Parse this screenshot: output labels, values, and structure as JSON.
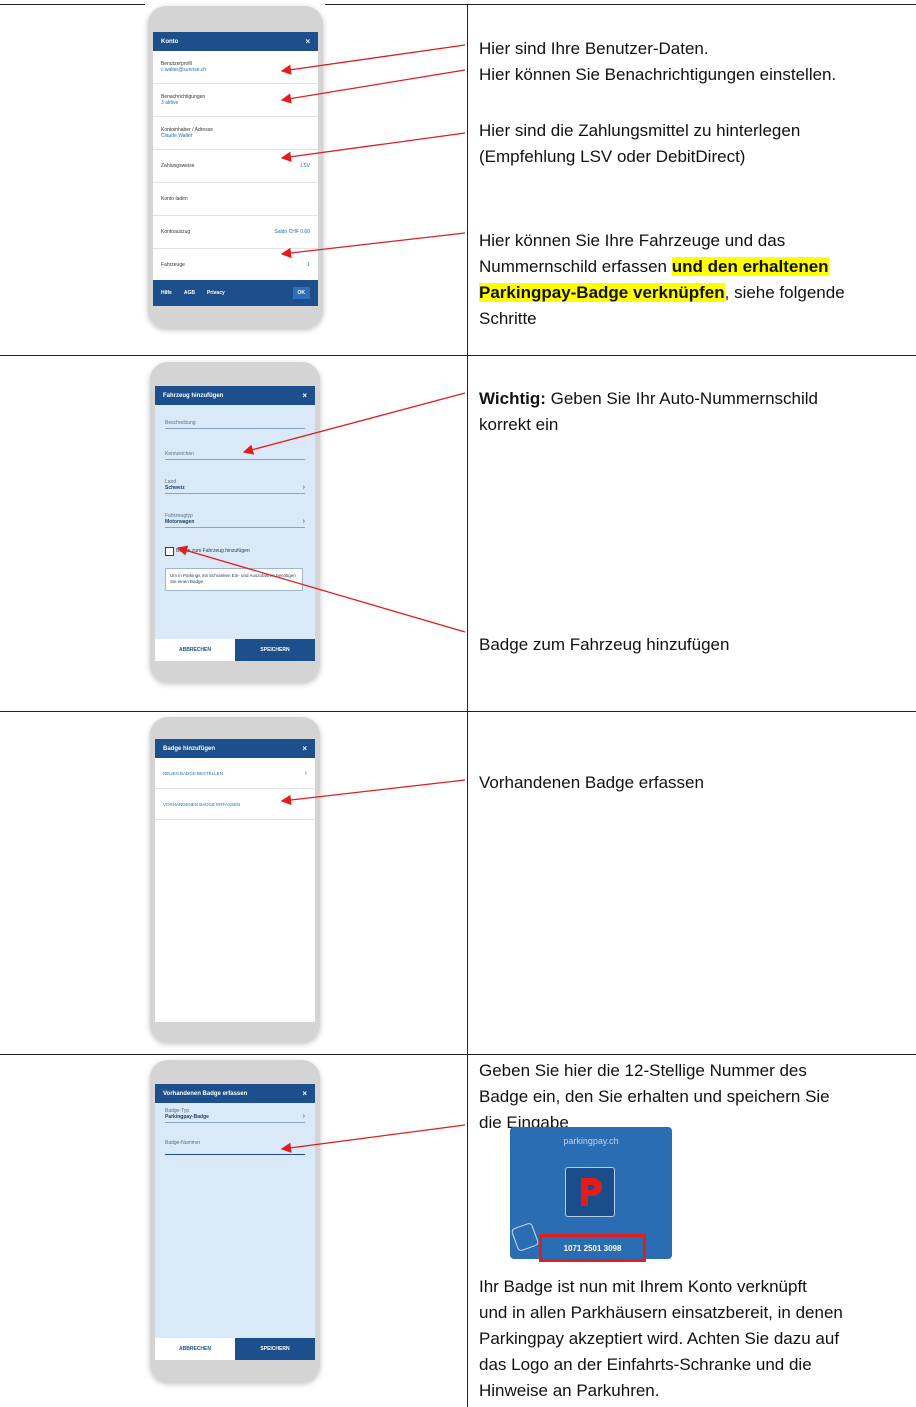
{
  "panel1": {
    "app_title": "Konto",
    "close": "×",
    "rows": [
      {
        "label": "Benutzerprofil",
        "sub": "c.walter@sunrise.ch",
        "value": ""
      },
      {
        "label": "Benachrichtigungen",
        "sub": "3 aktive",
        "value": ""
      },
      {
        "label": "Kontoinhaber / Adresse",
        "sub": "Claude Walter",
        "value": ""
      },
      {
        "label": "Zahlungsweise",
        "sub": "",
        "value": "LSV"
      },
      {
        "label": "Konto laden",
        "sub": "",
        "value": ""
      },
      {
        "label": "Kontoauszug",
        "sub": "",
        "value": "Saldo CHF 0.60"
      },
      {
        "label": "Fahrzeuge",
        "sub": "",
        "value": "1"
      }
    ],
    "footer": {
      "hilfe": "Hilfe",
      "agb": "AGB",
      "privacy": "Privacy",
      "ok": "OK"
    },
    "text_lines": [
      "Hier sind Ihre Benutzer-Daten.",
      "Hier können Sie Benachrichtigungen einstellen.",
      "Hier sind die Zahlungsmittel zu hinterlegen",
      "(Empfehlung LSV oder DebitDirect)"
    ],
    "vehicle_text_1": "Hier können Sie Ihre Fahrzeuge und das",
    "vehicle_text_2a": "Nummernschild erfassen ",
    "vehicle_text_2b": "und den erhaltenen",
    "vehicle_text_3a": "Parkingpay-Badge verknüpfen",
    "vehicle_text_3b": ", siehe folgende",
    "vehicle_text_4": "Schritte"
  },
  "panel2": {
    "app_title": "Fahrzeug hinzufügen",
    "close": "×",
    "field_beschreibung": "Beschreibung",
    "field_kennzeichen": "Kennzeichen",
    "land_label": "Land",
    "land_value": "Schweiz",
    "fahrzeugtyp_label": "Fahrzeugtyp",
    "fahrzeugtyp_value": "Motorwagen",
    "checkbox_label": "Badge zum Fahrzeug hinzufügen",
    "note": "Um in Parkings mit Schranken Ein- und Auszufahren benötigen Sie einen Badge.",
    "cancel": "ABBRECHEN",
    "save": "SPEICHERN",
    "text_bold": "Wichtig:",
    "text_rest": " Geben Sie Ihr Auto-Nummernschild",
    "text_line2": "korrekt ein",
    "text_badge": "Badge zum Fahrzeug hinzufügen"
  },
  "panel3": {
    "app_title": "Badge hinzufügen",
    "close": "×",
    "option_new": "NEUEN BADGE BESTELLEN",
    "option_existing": "VORHANDENEN BADGE ERFASSEN",
    "text": "Vorhandenen Badge erfassen"
  },
  "panel4": {
    "app_title": "Vorhandenen Badge erfassen",
    "close": "×",
    "badge_typ_label": "Badge-Typ",
    "badge_typ_value": "Parkingpay-Badge",
    "badge_nummer_label": "Badge-Nummer",
    "cancel": "ABBRECHEN",
    "save": "SPEICHERN",
    "text_top": [
      "Geben Sie hier die 12-Stellige Nummer des",
      "Badge ein, den Sie erhalten und speichern Sie",
      "die Eingabe"
    ],
    "card_brand": "parkingpay.ch",
    "card_number": "1071 2501 3098",
    "text_bottom": [
      "Ihr Badge ist nun mit Ihrem Konto verknüpft",
      "und in allen Parkhäusern einsatzbereit, in denen",
      "Parkingpay akzeptiert wird. Achten Sie dazu auf",
      "das Logo an der Einfahrts-Schranke und die",
      "Hinweise an Parkuhren."
    ]
  },
  "colors": {
    "brand_blue": "#1d4f8c",
    "highlight": "#ffff00",
    "arrow_red": "#e31c1c"
  }
}
